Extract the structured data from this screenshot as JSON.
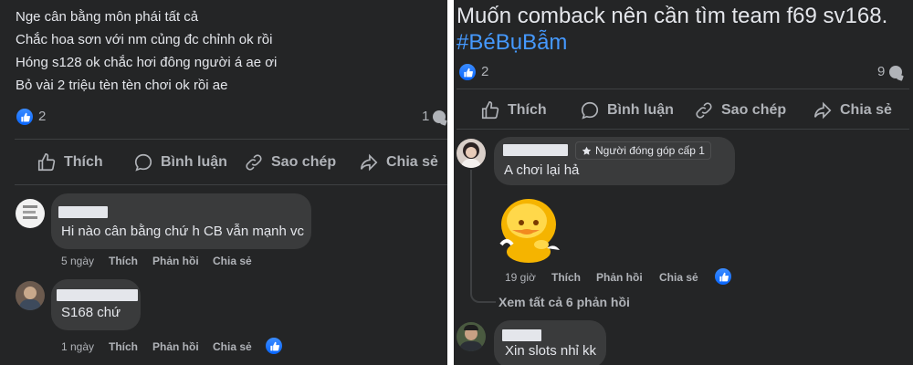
{
  "left": {
    "post_lines": [
      "Nge cân bằng môn phái tất cả",
      "Chắc hoa sơn với nm củng đc chỉnh ok rồi",
      "Hóng s128 ok chắc hơi đông người á ae ơi",
      "Bỏ vài 2 triệu tèn tèn chơi ok rồi ae"
    ],
    "reaction_count": "2",
    "comment_count": "1",
    "actions": {
      "like": "Thích",
      "comment": "Bình luận",
      "copy": "Sao chép",
      "share": "Chia sẻ"
    },
    "comments": [
      {
        "text": "Hi nào cân bằng chứ h CB vẫn mạnh vc",
        "time": "5 ngày",
        "like": "Thích",
        "reply": "Phản hồi",
        "share": "Chia sẻ"
      },
      {
        "text": "S168 chứ",
        "time": "1 ngày",
        "like": "Thích",
        "reply": "Phản hồi",
        "share": "Chia sẻ"
      }
    ]
  },
  "right": {
    "post_line": "Muốn comback nên cần tìm team f69 sv168.",
    "hashtag": "#BéBụBẫm",
    "reaction_count": "2",
    "comment_count": "9",
    "actions": {
      "like": "Thích",
      "comment": "Bình luận",
      "copy": "Sao chép",
      "share": "Chia sẻ"
    },
    "comments": [
      {
        "badge": "Người đóng góp cấp 1",
        "text": "A chơi lại hả",
        "time": "19 giờ",
        "like": "Thích",
        "reply": "Phản hồi",
        "share": "Chia sẻ"
      },
      {
        "text": "Xin slots nhỉ kk"
      }
    ],
    "view_replies": "Xem tất cả 6 phản hồi"
  },
  "colors": {
    "background": "#242526",
    "bubble": "#3a3b3c",
    "text": "#e4e6eb",
    "muted": "#b0b3b8",
    "accent": "#0866ff",
    "hashtag": "#4599ff"
  }
}
